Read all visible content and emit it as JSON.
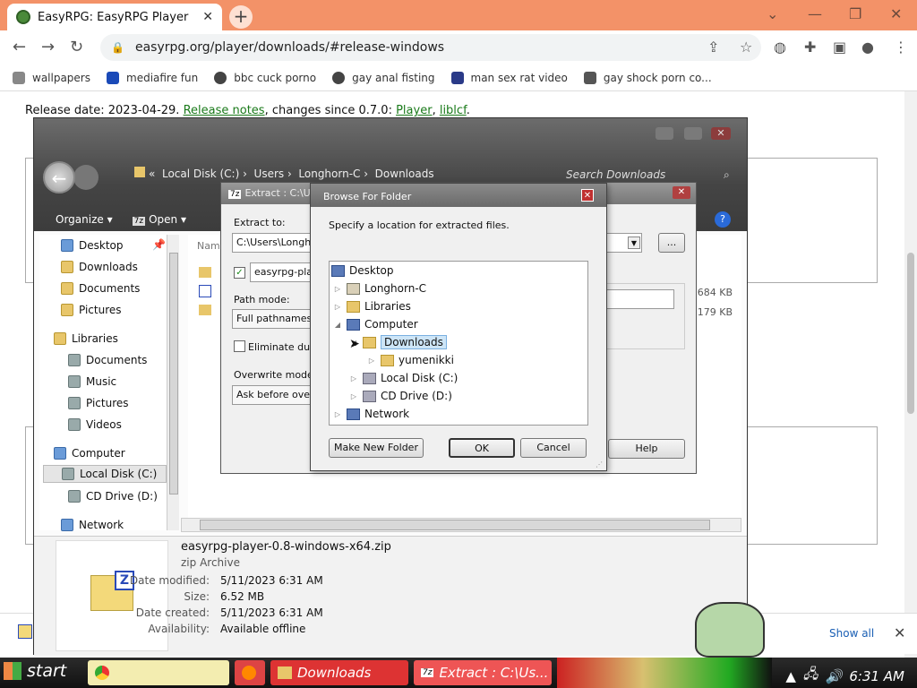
{
  "browser": {
    "tab_title": "EasyRPG: EasyRPG Player",
    "url": "easyrpg.org/player/downloads/#release-windows",
    "bookmarks": [
      "wallpapers",
      "mediafire fun",
      "bbc cuck porno",
      "gay anal fisting",
      "man sex rat video",
      "gay shock porn co..."
    ]
  },
  "page": {
    "release_prefix": "Release date: 2023-04-29. ",
    "release_notes_link": "Release notes",
    "changes_text": ", changes since 0.7.0: ",
    "player_link": "Player",
    "comma": ", ",
    "liblcf_link": "liblcf",
    "period": "."
  },
  "download_bar": {
    "show_all": "Show all"
  },
  "explorer": {
    "address": [
      "Local Disk (C:)",
      "Users",
      "Longhorn-C",
      "Downloads"
    ],
    "search_placeholder": "Search Downloads",
    "organize": "Organize",
    "open": "Open",
    "nav": {
      "desktop": "Desktop",
      "downloads": "Downloads",
      "documents": "Documents",
      "pictures": "Pictures",
      "libraries": "Libraries",
      "lib_documents": "Documents",
      "music": "Music",
      "lib_pictures": "Pictures",
      "videos": "Videos",
      "computer": "Computer",
      "local_disk": "Local Disk (C:)",
      "cd_drive": "CD Drive (D:)",
      "network": "Network"
    },
    "column_name": "Nam",
    "sizes": [
      "684 KB",
      "179 KB"
    ],
    "details": {
      "file_name": "easyrpg-player-0.8-windows-x64.zip",
      "file_type": "zip Archive",
      "date_modified_label": "Date modified:",
      "date_modified": "5/11/2023 6:31 AM",
      "size_label": "Size:",
      "size": "6.52 MB",
      "date_created_label": "Date created:",
      "date_created": "5/11/2023 6:31 AM",
      "availability_label": "Availability:",
      "availability": "Available offline"
    }
  },
  "extract_dialog": {
    "title": "Extract : C:\\Us",
    "extract_to_label": "Extract to:",
    "extract_to_value": "C:\\Users\\Longho",
    "browse_btn": "...",
    "subfolder_value": "easyrpg-playe",
    "path_mode_label": "Path mode:",
    "path_mode_value": "Full pathnames",
    "eliminate_label": "Eliminate dupli",
    "overwrite_label": "Overwrite mode:",
    "overwrite_value": "Ask before overw",
    "help_btn": "Help"
  },
  "browse_dialog": {
    "title": "Browse For Folder",
    "prompt": "Specify a location for extracted files.",
    "tree": {
      "desktop": "Desktop",
      "longhorn": "Longhorn-C",
      "libraries": "Libraries",
      "computer": "Computer",
      "downloads": "Downloads",
      "yumenikki": "yumenikki",
      "local_disk": "Local Disk (C:)",
      "cd_drive": "CD Drive (D:)",
      "network": "Network"
    },
    "make_new_folder": "Make New Folder",
    "ok": "OK",
    "cancel": "Cancel"
  },
  "taskbar": {
    "start": "start",
    "task_downloads": "Downloads",
    "task_extract": "Extract : C:\\Us...",
    "clock": "6:31 AM"
  }
}
